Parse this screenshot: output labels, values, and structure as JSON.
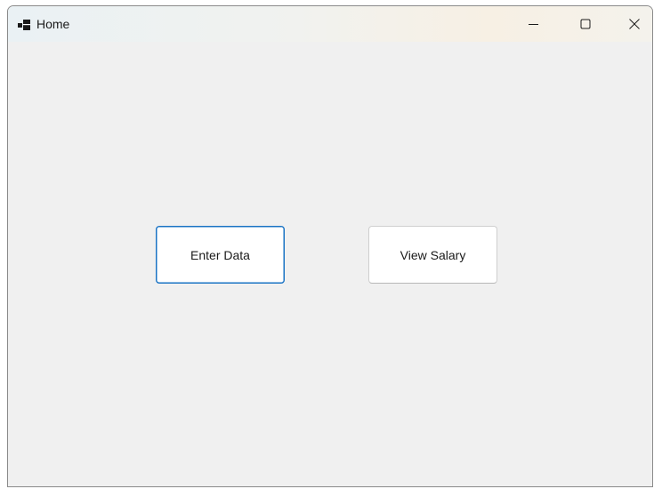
{
  "window": {
    "title": "Home",
    "icon": "app-window-icon",
    "controls": {
      "minimize": "minimize-icon",
      "maximize": "maximize-icon",
      "close": "close-icon"
    }
  },
  "main": {
    "enter_data_label": "Enter Data",
    "view_salary_label": "View Salary"
  },
  "colors": {
    "focus_border": "#1a73c4",
    "client_background": "#f0f0f0",
    "button_background": "#ffffff"
  }
}
